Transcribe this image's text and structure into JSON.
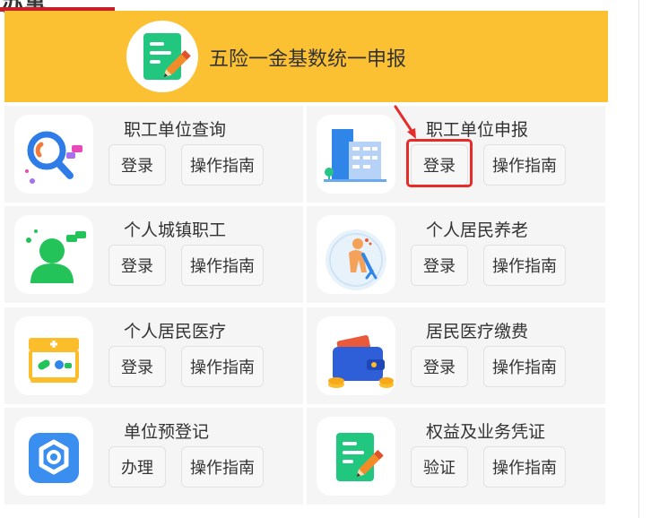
{
  "header": {
    "title_fragment": "办事"
  },
  "banner": {
    "title": "五险一金基数统一申报",
    "icon": "document-pencil-icon"
  },
  "cards": [
    {
      "title": "职工单位查询",
      "icon": "magnifier-chat-icon",
      "action": "登录",
      "guide": "操作指南"
    },
    {
      "title": "职工单位申报",
      "icon": "office-building-icon",
      "action": "登录",
      "guide": "操作指南"
    },
    {
      "title": "个人城镇职工",
      "icon": "person-chat-icon",
      "action": "登录",
      "guide": "操作指南"
    },
    {
      "title": "个人居民养老",
      "icon": "elderly-person-icon",
      "action": "登录",
      "guide": "操作指南"
    },
    {
      "title": "个人居民医疗",
      "icon": "pharmacy-store-icon",
      "action": "登录",
      "guide": "操作指南"
    },
    {
      "title": "居民医疗缴费",
      "icon": "wallet-coins-icon",
      "action": "登录",
      "guide": "操作指南"
    },
    {
      "title": "单位预登记",
      "icon": "gear-badge-icon",
      "action": "办理",
      "guide": "操作指南"
    },
    {
      "title": "权益及业务凭证",
      "icon": "document-pencil-icon",
      "action": "验证",
      "guide": "操作指南"
    }
  ],
  "annotation": {
    "highlight_color": "#e62b2b"
  },
  "colors": {
    "banner_bg": "#fbc132",
    "card_bg": "#f5f5f5",
    "green_icon": "#21c67f",
    "blue_icon": "#2f86e8"
  }
}
